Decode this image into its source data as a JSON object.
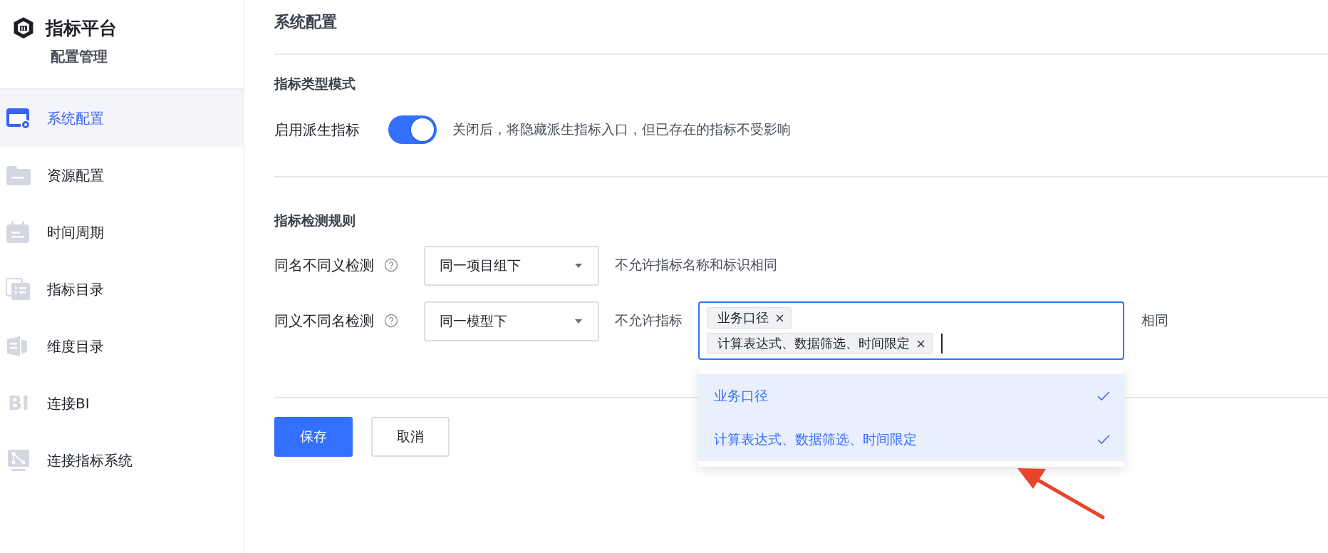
{
  "sidebar": {
    "title": "指标平台",
    "subtitle": "配置管理",
    "items": [
      {
        "label": "系统配置",
        "selected": true
      },
      {
        "label": "资源配置",
        "selected": false
      },
      {
        "label": "时间周期",
        "selected": false
      },
      {
        "label": "指标目录",
        "selected": false
      },
      {
        "label": "维度目录",
        "selected": false
      },
      {
        "label": "连接BI",
        "selected": false,
        "icon_text": "BI"
      },
      {
        "label": "连接指标系统",
        "selected": false
      }
    ]
  },
  "page_title": "系统配置",
  "type_mode": {
    "title": "指标类型模式",
    "label": "启用派生指标",
    "on": true,
    "hint": "关闭后，将隐藏派生指标入口，但已存在的指标不受影响"
  },
  "detection_rules": {
    "title": "指标检测规则",
    "rows": [
      {
        "kind": "hint",
        "label": "同名不同义检测",
        "select": "同一项目组下",
        "hint": "不允许指标名称和标识相同"
      },
      {
        "kind": "tags",
        "label": "同义不同名检测",
        "select": "同一模型下",
        "prefix": "不允许指标",
        "tags": [
          "业务口径",
          "计算表达式、数据筛选、时间限定"
        ],
        "suffix": "相同",
        "options": [
          {
            "label": "业务口径",
            "selected": true
          },
          {
            "label": "计算表达式、数据筛选、时间限定",
            "selected": true
          }
        ]
      }
    ]
  },
  "buttons": [
    {
      "label": "保存",
      "kind": "primary"
    },
    {
      "label": "取消",
      "kind": "default"
    }
  ]
}
